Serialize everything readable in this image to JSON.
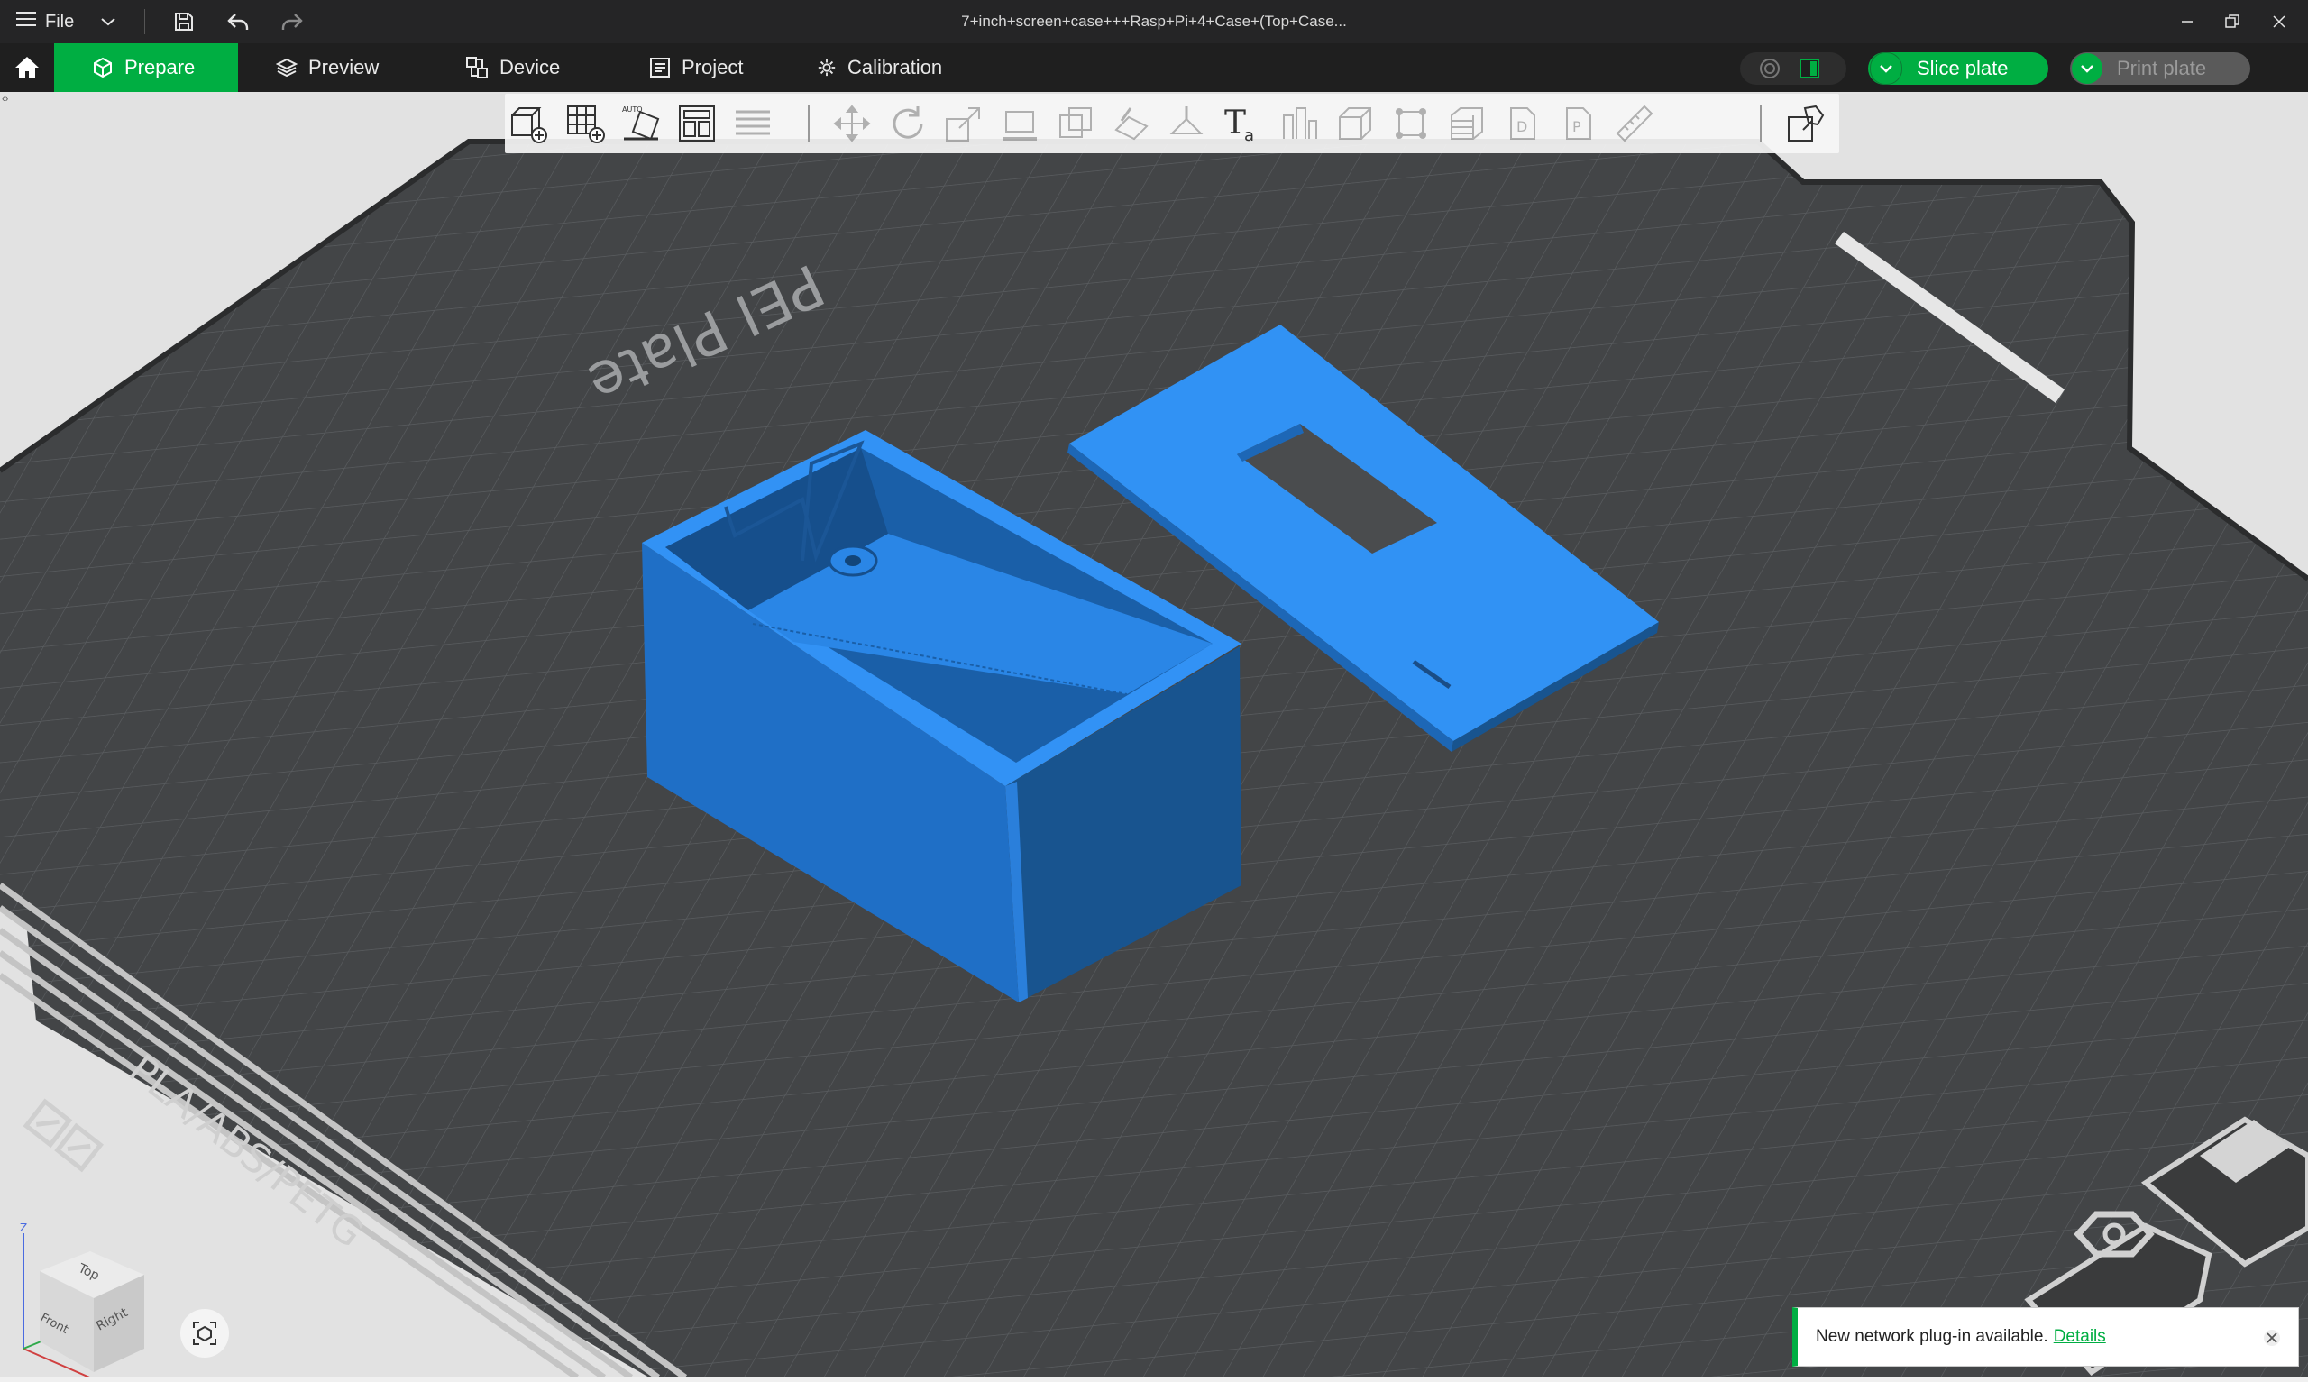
{
  "titlebar": {
    "file_label": "File",
    "window_title": "7+inch+screen+case+++Rasp+Pi+4+Case+(Top+Case...",
    "icons": [
      "menu-icon",
      "chevron-down-icon",
      "save-icon",
      "undo-icon",
      "redo-icon",
      "minimize-icon",
      "restore-icon",
      "close-icon"
    ]
  },
  "nav": {
    "tabs": [
      {
        "label": "Prepare",
        "icon": "cube-icon",
        "active": true
      },
      {
        "label": "Preview",
        "icon": "layers-icon",
        "active": false
      },
      {
        "label": "Device",
        "icon": "device-icon",
        "active": false
      },
      {
        "label": "Project",
        "icon": "project-icon",
        "active": false
      },
      {
        "label": "Calibration",
        "icon": "calibration-icon",
        "active": false
      }
    ],
    "slice_label": "Slice plate",
    "print_label": "Print plate",
    "print_enabled": false,
    "accent_color": "#00ae42"
  },
  "toolbar": {
    "tools": [
      {
        "name": "add-object-icon",
        "enabled": true
      },
      {
        "name": "add-plate-icon",
        "enabled": true
      },
      {
        "name": "auto-orient-icon",
        "enabled": true
      },
      {
        "name": "arrange-icon",
        "enabled": true
      },
      {
        "name": "split-to-layers-icon",
        "enabled": false
      },
      {
        "name": "move-icon",
        "enabled": false
      },
      {
        "name": "rotate-icon",
        "enabled": false
      },
      {
        "name": "scale-icon",
        "enabled": false
      },
      {
        "name": "lay-on-face-icon",
        "enabled": false
      },
      {
        "name": "cut-icon",
        "enabled": false
      },
      {
        "name": "boolean-icon",
        "enabled": false
      },
      {
        "name": "support-paint-icon",
        "enabled": false
      },
      {
        "name": "seam-paint-icon",
        "enabled": false
      },
      {
        "name": "text-icon",
        "enabled": true
      },
      {
        "name": "measure-box-icon",
        "enabled": false
      },
      {
        "name": "assembly-icon",
        "enabled": false
      },
      {
        "name": "brim-ears-icon",
        "enabled": false
      },
      {
        "name": "variable-layer-icon",
        "enabled": false
      },
      {
        "name": "part-icon",
        "enabled": false
      },
      {
        "name": "modifier-icon",
        "enabled": false
      },
      {
        "name": "ruler-icon",
        "enabled": false
      },
      {
        "name": "assembly-view-icon",
        "enabled": true
      }
    ]
  },
  "plate": {
    "plate_text": "PEI Plate",
    "material_text": "PLA/ABS/PETG",
    "model_color": "#2e8ff0"
  },
  "viewcube": {
    "top": "Top",
    "front": "Front",
    "right": "Right",
    "z_axis": "Z"
  },
  "notification": {
    "message": "New network plug-in available.",
    "link": "Details"
  }
}
